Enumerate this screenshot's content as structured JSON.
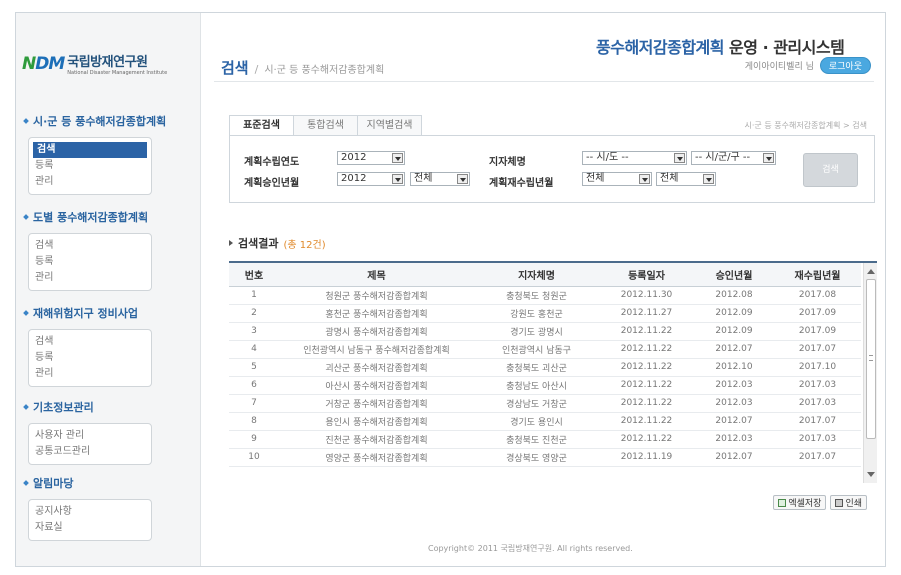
{
  "header": {
    "title_accent": "풍수해저감종합계획",
    "title_rest": " 운영 · 관리시스템",
    "user_name": "게이아이티벨리 님",
    "logout_label": "로그아웃"
  },
  "logo": {
    "mark_n": "N",
    "mark_dm": "DM",
    "name_ko": "국립방재연구원",
    "name_en": "National Disaster Management Institute"
  },
  "breadcrumb": {
    "current": "검색",
    "separator": "/",
    "sub": "시·군 등 풍수해저감종합계획"
  },
  "sidebar": {
    "groups": [
      {
        "title": "시·군 등 풍수해저감종합계획",
        "items": [
          "검색",
          "등록",
          "관리"
        ],
        "active": 0
      },
      {
        "title": "도별 풍수해저감종합계획",
        "items": [
          "검색",
          "등록",
          "관리"
        ]
      },
      {
        "title": "재해위험지구 정비사업",
        "items": [
          "검색",
          "등록",
          "관리"
        ]
      },
      {
        "title": "기초정보관리",
        "items": [
          "사용자 관리",
          "공통코드관리"
        ]
      },
      {
        "title": "알림마당",
        "items": [
          "공지사항",
          "자료실"
        ]
      }
    ]
  },
  "tabs": {
    "items": [
      "표준검색",
      "통합검색",
      "지역별검색"
    ],
    "path": "시·군 등 풍수해저감종합계획 > 검색"
  },
  "search": {
    "plan_year_label": "계획수립연도",
    "plan_year_value": "2012",
    "approve_year_label": "계획승인년월",
    "approve_year_value": "2012",
    "approve_month_value": "전체",
    "region_label": "지자체명",
    "sido_value": "-- 시/도 --",
    "sigungu_value": "-- 시/군/구 --",
    "reestablish_label": "계획재수립년월",
    "re_year_value": "전체",
    "re_month_value": "전체",
    "button_label": "검색"
  },
  "results": {
    "title": "검색결과",
    "count": "(총 12건)",
    "columns": [
      "번호",
      "제목",
      "지자체명",
      "등록일자",
      "승인년월",
      "재수립년월"
    ],
    "rows": [
      [
        "1",
        "청원군 풍수해저감종합계획",
        "충청북도 청원군",
        "2012.11.30",
        "2012.08",
        "2017.08"
      ],
      [
        "2",
        "홍천군 풍수해저감종합계획",
        "강원도 홍천군",
        "2012.11.27",
        "2012.09",
        "2017.09"
      ],
      [
        "3",
        "광명시 풍수해저감종합계획",
        "경기도 광명시",
        "2012.11.22",
        "2012.09",
        "2017.09"
      ],
      [
        "4",
        "인천광역시 남동구 풍수해저감종합계획",
        "인천광역시 남동구",
        "2012.11.22",
        "2012.07",
        "2017.07"
      ],
      [
        "5",
        "괴산군 풍수해저감종합계획",
        "충청북도 괴산군",
        "2012.11.22",
        "2012.10",
        "2017.10"
      ],
      [
        "6",
        "아산시 풍수해저감종합계획",
        "충청남도 아산시",
        "2012.11.22",
        "2012.03",
        "2017.03"
      ],
      [
        "7",
        "거창군 풍수해저감종합계획",
        "경상남도 거창군",
        "2012.11.22",
        "2012.03",
        "2017.03"
      ],
      [
        "8",
        "용인시 풍수해저감종합계획",
        "경기도 용인시",
        "2012.11.22",
        "2012.07",
        "2017.07"
      ],
      [
        "9",
        "진천군 풍수해저감종합계획",
        "충청북도 진천군",
        "2012.11.22",
        "2012.03",
        "2017.03"
      ],
      [
        "10",
        "영양군 풍수해저감종합계획",
        "경상북도 영양군",
        "2012.11.19",
        "2012.07",
        "2017.07"
      ]
    ]
  },
  "actions": {
    "excel_label": "엑셀저장",
    "print_label": "인쇄"
  },
  "footer": {
    "copyright": "Copyright© 2011 국립방재연구원. All rights reserved."
  }
}
